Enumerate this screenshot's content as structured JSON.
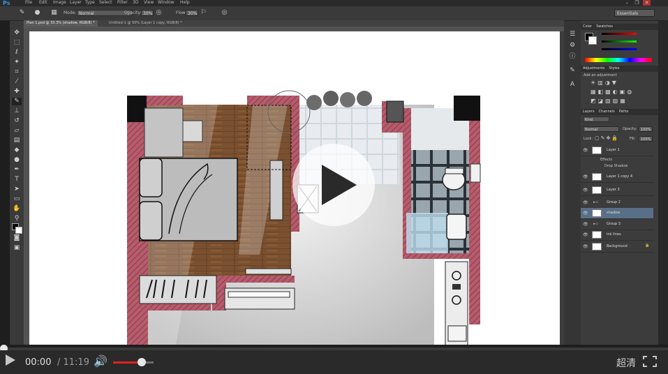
{
  "app": {
    "logo": "Ps"
  },
  "menu": {
    "items": [
      "File",
      "Edit",
      "Image",
      "Layer",
      "Type",
      "Select",
      "Filter",
      "3D",
      "View",
      "Window",
      "Help"
    ]
  },
  "options": {
    "mode_label": "Mode:",
    "mode_value": "Normal",
    "opacity_label": "Opacity:",
    "opacity_value": "30%",
    "flow_label": "Flow:",
    "flow_value": "30%",
    "workspace": "Essentials"
  },
  "tabs": [
    {
      "label": "Plan 1.psd @ 33.3% (shadow, RGB/8) *"
    },
    {
      "label": "Untitled-1 @ 50% (Layer 1 copy, RGB/8) *"
    }
  ],
  "panels": {
    "color": {
      "tab1": "Color",
      "tab2": "Swatches"
    },
    "adjustments": {
      "tab1": "Adjustments",
      "tab2": "Styles",
      "hint": "Add an adjustment"
    },
    "layers": {
      "tab1": "Layers",
      "tab2": "Channels",
      "tab3": "Paths",
      "kind": "Kind",
      "blend": "Normal",
      "opacity_label": "Opacity:",
      "opacity_value": "100%",
      "lock_label": "Lock:",
      "fill_label": "Fill:",
      "fill_value": "100%"
    },
    "layer_items": [
      {
        "name": "Layer 1",
        "selected": false
      },
      {
        "name": "Effects",
        "selected": false
      },
      {
        "name": "Drop Shadow",
        "selected": false
      },
      {
        "name": "Layer 1 copy 4",
        "selected": false
      },
      {
        "name": "Layer 3",
        "selected": false
      },
      {
        "name": "Group 2",
        "selected": false
      },
      {
        "name": "shadow",
        "selected": true
      },
      {
        "name": "Group 3",
        "selected": false
      },
      {
        "name": "ink lines",
        "selected": false
      },
      {
        "name": "Background",
        "selected": false
      }
    ]
  },
  "player": {
    "time_current": "00:00",
    "time_total": "/ 11:19",
    "quality": "超清",
    "progress": 0,
    "volume": 0.7
  },
  "colors": {
    "wall": "#b55b6b",
    "wood": "#7a5030",
    "accent_red": "#e02020"
  }
}
